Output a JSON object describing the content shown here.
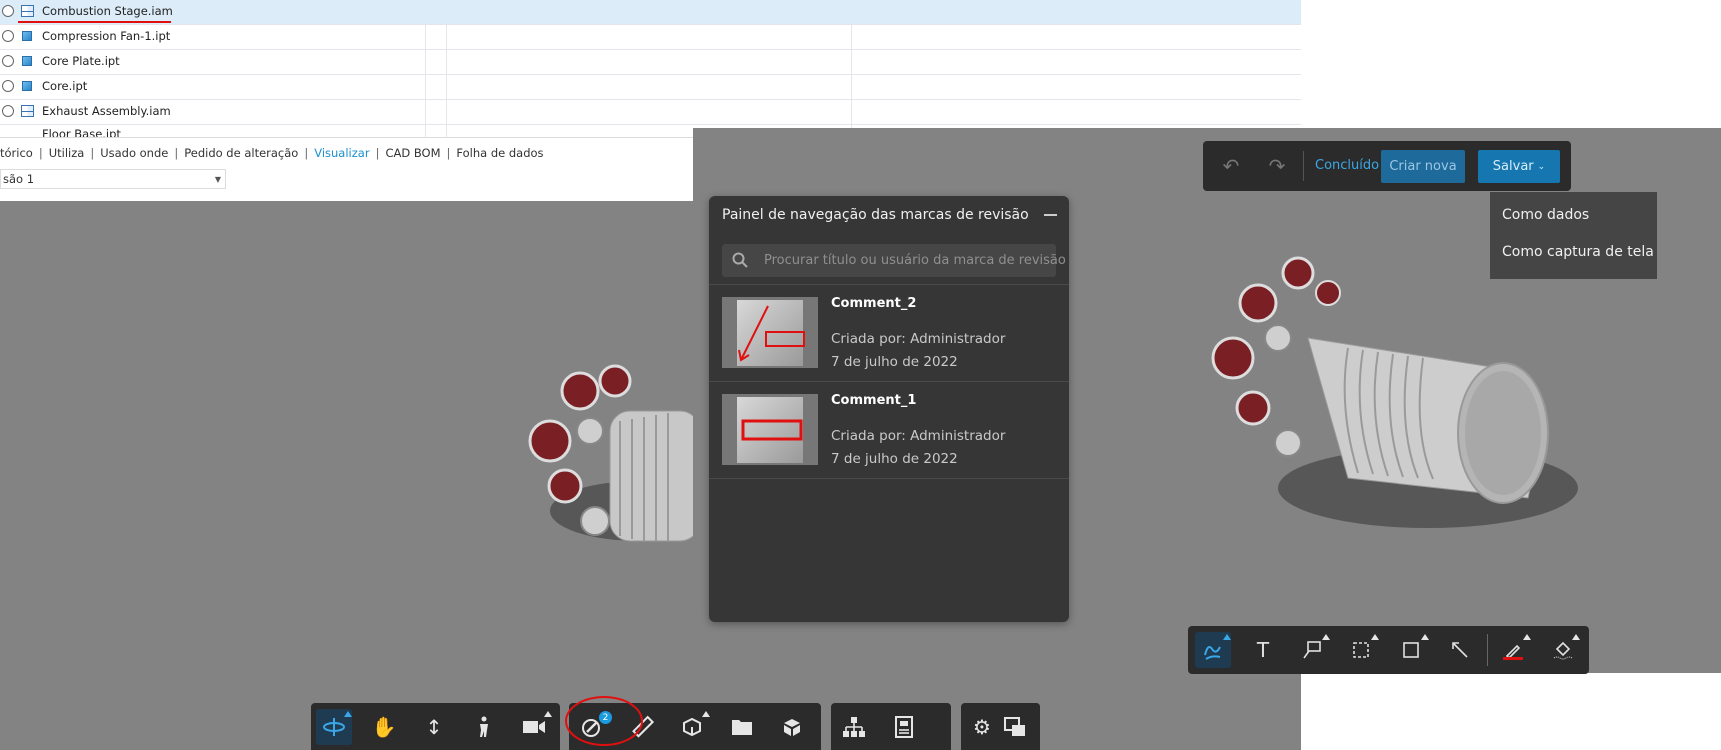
{
  "file_list": {
    "rows": [
      {
        "name": "Combustion Stage.iam",
        "type": "assembly",
        "selected": true
      },
      {
        "name": "Compression Fan-1.ipt",
        "type": "part",
        "selected": false
      },
      {
        "name": "Core Plate.ipt",
        "type": "part",
        "selected": false
      },
      {
        "name": "Core.ipt",
        "type": "part",
        "selected": false
      },
      {
        "name": "Exhaust Assembly.iam",
        "type": "assembly",
        "selected": false
      },
      {
        "name": "Floor Base.ipt",
        "type": "part",
        "selected": false
      }
    ]
  },
  "tabs": {
    "items": [
      "tórico",
      "Utiliza",
      "Usado onde",
      "Pedido de alteração",
      "Visualizar",
      "CAD BOM",
      "Folha de dados"
    ],
    "active": "Visualizar"
  },
  "version_select": {
    "value": "são 1"
  },
  "markup_bar": {
    "undo_icon": "undo-icon",
    "redo_icon": "redo-icon",
    "done_label": "Concluído",
    "create_new_label": "Criar nova",
    "save_label": "Salvar"
  },
  "save_menu": {
    "items": [
      "Como dados",
      "Como captura de tela"
    ]
  },
  "nav_panel": {
    "title": "Painel de navegação das marcas de revisão",
    "search_placeholder": "Procurar título ou usuário da marca de revisão",
    "comments": [
      {
        "title": "Comment_2",
        "created_by": "Criada por: Administrador",
        "date": "7 de julho de 2022"
      },
      {
        "title": "Comment_1",
        "created_by": "Criada por: Administrador",
        "date": "7 de julho de 2022"
      }
    ]
  },
  "bottom_toolbar": {
    "markup_badge": "2",
    "icons": [
      "orbit-icon",
      "pan-icon",
      "zoom-icon",
      "walk-icon",
      "camera-icon",
      "markup-icon",
      "measure-icon",
      "section-icon",
      "folder-icon",
      "explode-icon",
      "structure-icon",
      "properties-icon",
      "settings-icon",
      "fullscreen-icon"
    ]
  },
  "markup_tools": {
    "icons": [
      "freehand-icon",
      "text-icon",
      "callout-icon",
      "cloud-icon",
      "rectangle-icon",
      "arrow-icon",
      "pen-color-icon",
      "fill-icon"
    ],
    "pen_color": "#e01010",
    "accent": "#3aa8e8"
  }
}
